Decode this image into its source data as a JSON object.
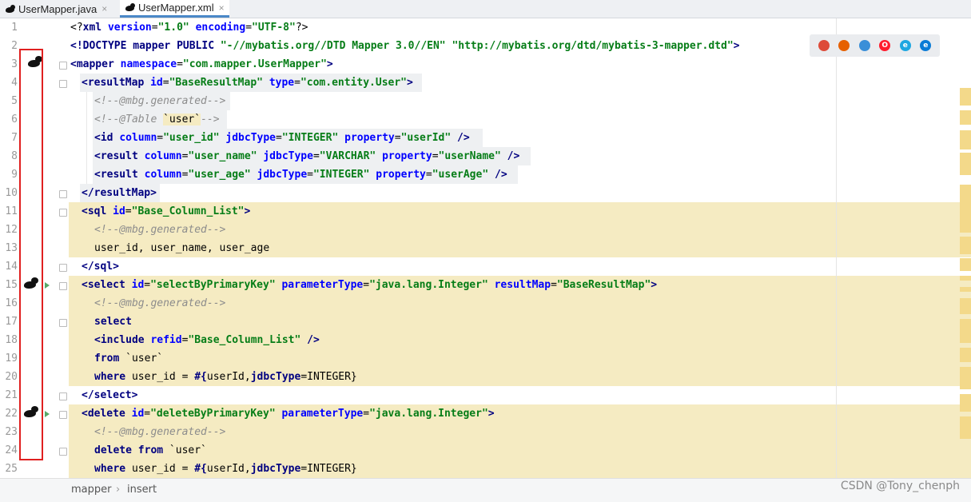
{
  "tabs": [
    {
      "label": "UserMapper.java",
      "close": "×",
      "active": false
    },
    {
      "label": "UserMapper.xml",
      "close": "×",
      "active": true
    }
  ],
  "line_numbers": [
    "1",
    "2",
    "3",
    "4",
    "5",
    "6",
    "7",
    "8",
    "9",
    "10",
    "11",
    "12",
    "13",
    "14",
    "15",
    "16",
    "17",
    "18",
    "19",
    "20",
    "21",
    "22",
    "23",
    "24",
    "25"
  ],
  "code": {
    "l1": {
      "a": "<?",
      "b": "xml ",
      "c": "version",
      "d": "=",
      "e": "\"1.0\"",
      "f": " ",
      "g": "encoding",
      "h": "=",
      "i": "\"UTF-8\"",
      "j": "?>"
    },
    "l2": {
      "a": "<!DOCTYPE ",
      "b": "mapper PUBLIC ",
      "c": "\"-//mybatis.org//DTD Mapper 3.0//EN\"",
      "d": " ",
      "e": "\"http://mybatis.org/dtd/mybatis-3-mapper.dtd\"",
      "f": ">"
    },
    "l3": {
      "a": "<mapper ",
      "b": "namespace",
      "c": "=",
      "d": "\"com.mapper.UserMapper\"",
      "e": ">"
    },
    "l4": {
      "a": "<resultMap ",
      "b": "id",
      "c": "=",
      "d": "\"BaseResultMap\"",
      "e": " ",
      "f": "type",
      "g": "=",
      "h": "\"com.entity.User\"",
      "i": ">"
    },
    "l5": {
      "a": "<!--@mbg.generated-->"
    },
    "l6": {
      "a": "<!--@Table ",
      "b": "`user`",
      "c": "-->"
    },
    "l7": {
      "a": "<id ",
      "b": "column",
      "c": "=",
      "d": "\"user_id\"",
      "e": " ",
      "f": "jdbcType",
      "g": "=",
      "h": "\"INTEGER\"",
      "i": " ",
      "j": "property",
      "k": "=",
      "l": "\"userId\"",
      "m": " />"
    },
    "l8": {
      "a": "<result ",
      "b": "column",
      "c": "=",
      "d": "\"user_name\"",
      "e": " ",
      "f": "jdbcType",
      "g": "=",
      "h": "\"VARCHAR\"",
      "i": " ",
      "j": "property",
      "k": "=",
      "l": "\"userName\"",
      "m": " />"
    },
    "l9": {
      "a": "<result ",
      "b": "column",
      "c": "=",
      "d": "\"user_age\"",
      "e": " ",
      "f": "jdbcType",
      "g": "=",
      "h": "\"INTEGER\"",
      "i": " ",
      "j": "property",
      "k": "=",
      "l": "\"userAge\"",
      "m": " />"
    },
    "l10": {
      "a": "</resultMap>"
    },
    "l11": {
      "a": "<sql ",
      "b": "id",
      "c": "=",
      "d": "\"Base_Column_List\"",
      "e": ">"
    },
    "l12": {
      "a": "<!--@mbg.generated-->"
    },
    "l13": {
      "a": "user_id, user_name, user_age"
    },
    "l14": {
      "a": "</sql>"
    },
    "l15": {
      "a": "<select ",
      "b": "id",
      "c": "=",
      "d": "\"selectByPrimaryKey\"",
      "e": " ",
      "f": "parameterType",
      "g": "=",
      "h": "\"java.lang.Integer\"",
      "i": " ",
      "j": "resultMap",
      "k": "=",
      "l": "\"BaseResultMap\"",
      "m": ">"
    },
    "l16": {
      "a": "<!--@mbg.generated-->"
    },
    "l17": {
      "a": "select"
    },
    "l18": {
      "a": "<include ",
      "b": "refid",
      "c": "=",
      "d": "\"Base_Column_List\"",
      "e": " />"
    },
    "l19": {
      "a": "from",
      "b": " `user`"
    },
    "l20": {
      "a": "where",
      "b": " user_id = ",
      "c": "#{",
      "d": "userId,",
      "e": "jdbcType",
      "f": "=INTEGER}"
    },
    "l21": {
      "a": "</select>"
    },
    "l22": {
      "a": "<delete ",
      "b": "id",
      "c": "=",
      "d": "\"deleteByPrimaryKey\"",
      "e": " ",
      "f": "parameterType",
      "g": "=",
      "h": "\"java.lang.Integer\"",
      "i": ">"
    },
    "l23": {
      "a": "<!--@mbg.generated-->"
    },
    "l24": {
      "a": "delete from",
      "b": " `user`"
    },
    "l25": {
      "a": "where",
      "b": " user_id = ",
      "c": "#{",
      "d": "userId,",
      "e": "jdbcType",
      "f": "=INTEGER}"
    }
  },
  "browser_icons": [
    {
      "name": "chrome-icon",
      "glyph": "",
      "color": "#dd4b39"
    },
    {
      "name": "firefox-icon",
      "glyph": "",
      "color": "#e66000"
    },
    {
      "name": "safari-icon",
      "glyph": "",
      "color": "#3a8fd8"
    },
    {
      "name": "opera-icon",
      "glyph": "O",
      "color": "#ff1b2d"
    },
    {
      "name": "ie-icon",
      "glyph": "e",
      "color": "#1ea7e1"
    },
    {
      "name": "edge-icon",
      "glyph": "e",
      "color": "#0a7bd6"
    }
  ],
  "breadcrumbs": {
    "first": "mapper",
    "sep": "›",
    "second": "insert"
  },
  "watermark": "CSDN @Tony_chenph",
  "colors": {
    "tag": "#000080",
    "attr": "#0000ff",
    "value": "#067d17",
    "comment": "#8c8c8c",
    "highlight": "#f5ebc2",
    "annotation_box": "#e02020"
  }
}
